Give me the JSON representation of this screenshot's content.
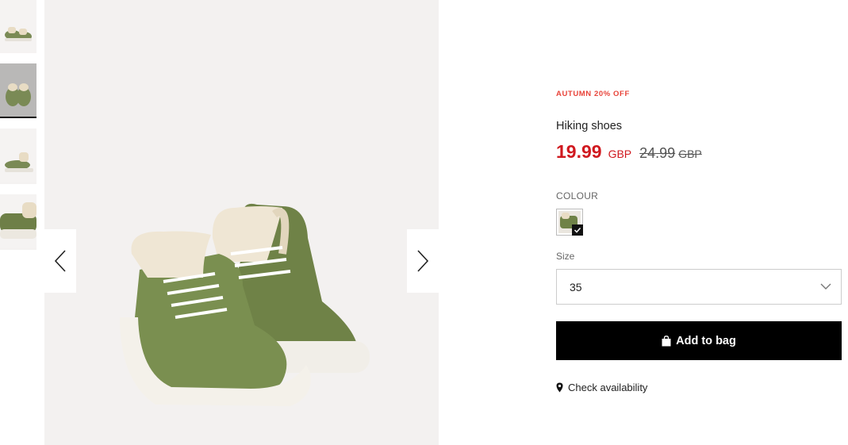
{
  "product": {
    "promo": "AUTUMN 20% OFF",
    "name": "Hiking shoes",
    "price": "19.99",
    "currency": "GBP",
    "old_price": "24.99",
    "old_currency": "GBP"
  },
  "colour": {
    "label": "COLOUR",
    "selected_swatch": "#7a8a55"
  },
  "size": {
    "label": "Size",
    "selected": "35"
  },
  "actions": {
    "add_to_bag": "Add to bag",
    "check_availability": "Check availability"
  },
  "icons": {
    "prev": "chevron-left-icon",
    "next": "chevron-right-icon",
    "dropdown": "chevron-down-icon",
    "bag": "shopping-bag-icon",
    "location": "location-pin-icon",
    "check": "check-icon"
  },
  "colors": {
    "promo": "#e8443a",
    "sale_price": "#d0191f",
    "button_bg": "#000000"
  }
}
